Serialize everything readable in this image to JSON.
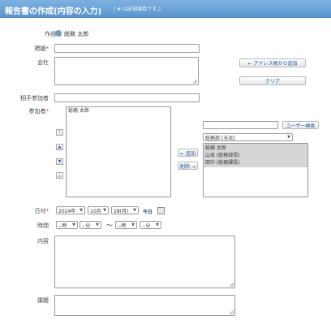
{
  "header": {
    "title": "報告書の作成(内容の入力)",
    "required_note": "( # は必須項目です。)"
  },
  "form": {
    "creator_label": "作成者",
    "creator_name": "総務 太郎",
    "subject_label": "標題",
    "subject_required": "*",
    "subject_value": "",
    "company_label": "会社",
    "company_value": "",
    "counterpart_label": "相手参加者",
    "counterpart_value": "",
    "participants_label": "参加者",
    "participants_required": "*",
    "participants": [
      "総務 太郎"
    ],
    "date_label": "日付",
    "date_required": "*",
    "time_label": "時間",
    "time_separator": "～",
    "content_label": "内容",
    "content_value": "",
    "issues_label": "課題",
    "issues_value": ""
  },
  "buttons": {
    "address_book": "← アドレス帳から追加",
    "clear": "クリア",
    "user_search": "ユーザー検索",
    "add": "← 追加",
    "remove": "削除 →",
    "today": "今日",
    "move_top": "⤒",
    "move_up": "▲",
    "move_down": "▼",
    "move_bottom": "⤓"
  },
  "user_picker": {
    "search_value": "",
    "group_selected": "総務部 [未派]",
    "users": [
      "総務 太郎",
      "山本 (総務部長)",
      "田中 (総務課長)"
    ]
  },
  "date": {
    "year": "2024年",
    "month": "10月",
    "day": "28(月)"
  },
  "time": {
    "start_hour": "--時",
    "start_min": "--分",
    "end_hour": "--時",
    "end_min": "--分"
  },
  "colors": {
    "header": "#6fa4d8",
    "link_blue": "#1f4f9a",
    "required": "#dd3333"
  }
}
